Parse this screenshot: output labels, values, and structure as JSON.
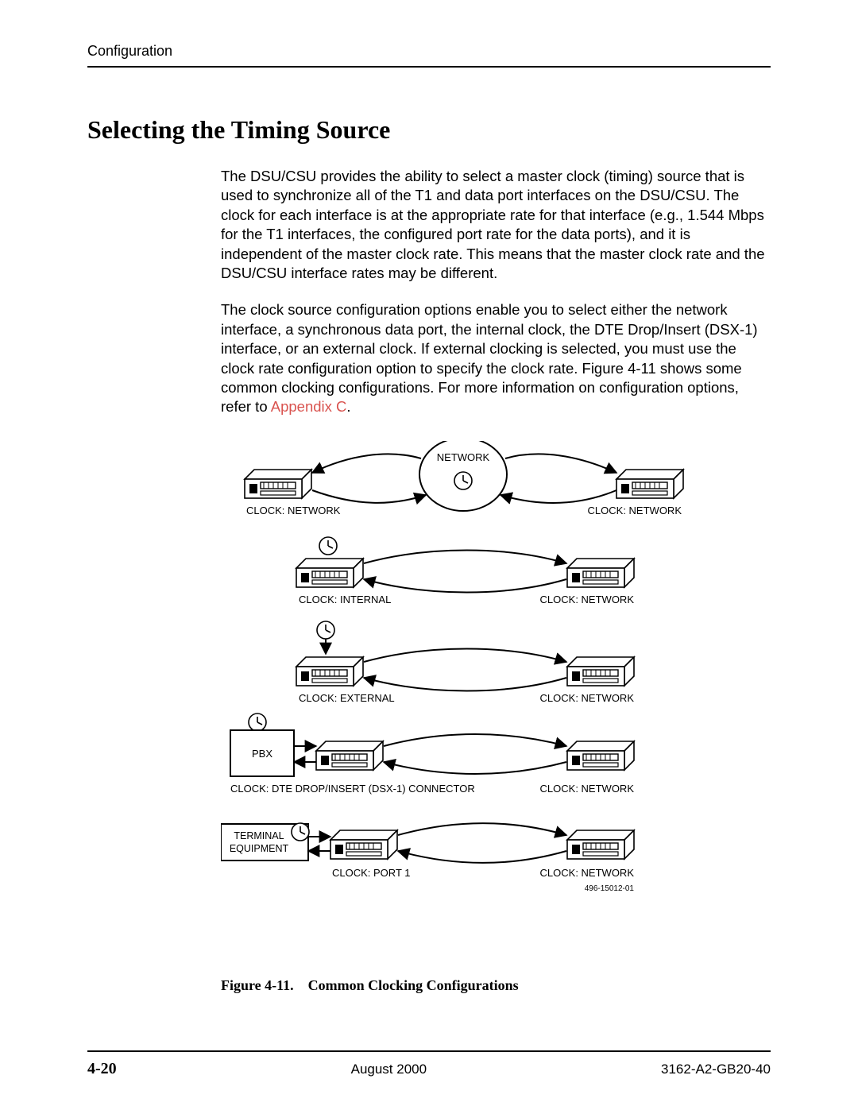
{
  "header": {
    "section": "Configuration"
  },
  "title": "Selecting the Timing Source",
  "paragraphs": {
    "p1": "The DSU/CSU provides the ability to select a master clock (timing) source that is used to synchronize all of the T1 and data port interfaces on the DSU/CSU. The clock for each interface is at the appropriate rate for that interface (e.g., 1.544 Mbps for the T1 interfaces, the configured port rate for the data ports), and it is independent of the master clock rate. This means that the master clock rate and the DSU/CSU interface rates may be different.",
    "p2a": "The clock source configuration options enable you to select either the network interface, a synchronous data port, the internal clock, the DTE Drop/Insert (DSX-1) interface, or an external clock. If external clocking is selected, you must use the clock rate configuration option to specify the clock rate. Figure 4-11 shows some common clocking configurations. For more information on configuration options, refer to ",
    "p2link": "Appendix C",
    "p2b": "."
  },
  "diagram": {
    "network_label": "NETWORK",
    "row1_left": "CLOCK: NETWORK",
    "row1_right": "CLOCK: NETWORK",
    "row2_left": "CLOCK: INTERNAL",
    "row2_right": "CLOCK: NETWORK",
    "row3_left": "CLOCK: EXTERNAL",
    "row3_right": "CLOCK: NETWORK",
    "pbx": "PBX",
    "row4_left": "CLOCK: DTE DROP/INSERT (DSX-1) CONNECTOR",
    "row4_right": "CLOCK: NETWORK",
    "terminal1": "TERMINAL",
    "terminal2": "EQUIPMENT",
    "row5_left": "CLOCK: PORT 1",
    "row5_right": "CLOCK: NETWORK",
    "drawing_id": "496-15012-01"
  },
  "figure_caption": "Figure 4-11. Common Clocking Configurations",
  "footer": {
    "page": "4-20",
    "date": "August 2000",
    "doc": "3162-A2-GB20-40"
  }
}
